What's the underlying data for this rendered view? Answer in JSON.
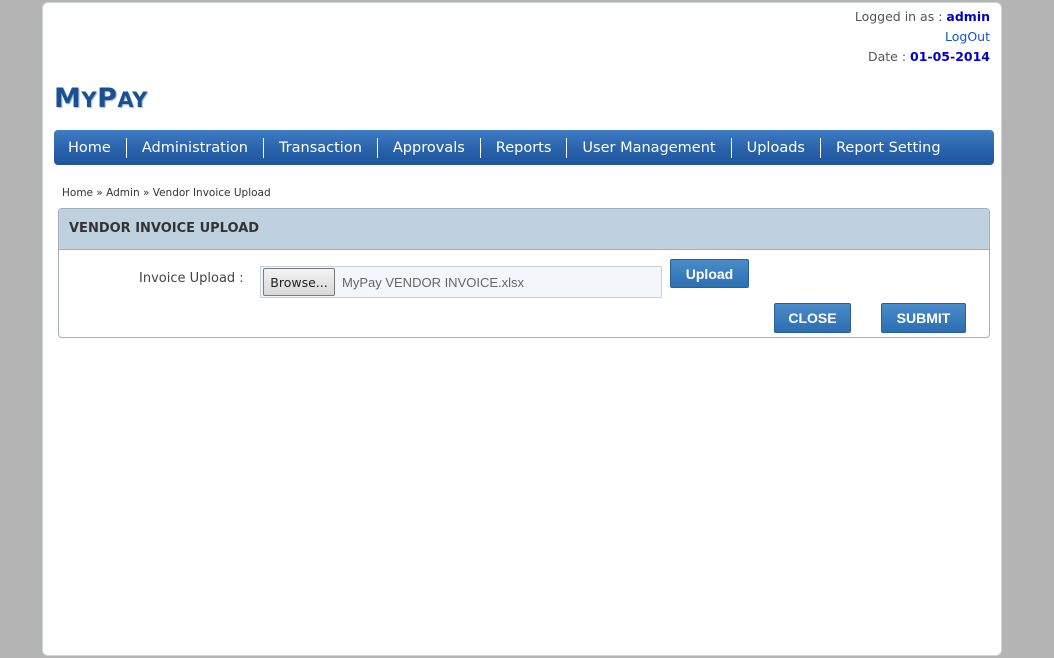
{
  "header": {
    "logged_in_label": "Logged in as :",
    "username": "admin",
    "logout": "LogOut",
    "date_label": "Date :",
    "date": "01-05-2014"
  },
  "logo": {
    "letter1": "M",
    "rest1": "Y",
    "letter2": "P",
    "rest2": "AY"
  },
  "nav": {
    "items": [
      "Home",
      "Administration",
      "Transaction",
      "Approvals",
      "Reports",
      "User Management",
      "Uploads",
      "Report Setting"
    ]
  },
  "breadcrumb": {
    "home": "Home",
    "sep1": "»",
    "admin": "Admin",
    "sep2": "»",
    "current": "Vendor Invoice Upload"
  },
  "panel": {
    "title": "VENDOR INVOICE UPLOAD",
    "field_label": "Invoice Upload :",
    "browse_label": "Browse...",
    "file_name": "MyPay VENDOR INVOICE.xlsx",
    "upload_label": "Upload",
    "close_label": "CLOSE",
    "submit_label": "SUBMIT"
  },
  "colors": {
    "nav_bar": "#2a64ad",
    "panel_header": "#bfd1de",
    "button": "#2b6fb2",
    "username": "#0000cc"
  }
}
